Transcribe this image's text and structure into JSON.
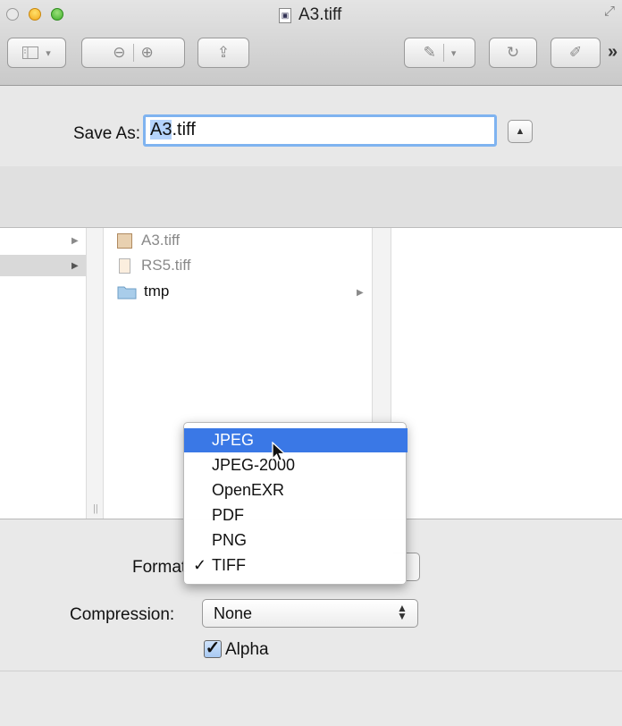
{
  "window": {
    "title": "A3.tiff",
    "title_icon_glyph": "▣",
    "fullscreen_glyph": "⤢"
  },
  "toolbar": {
    "sidebar_icon": "sidebar-icon",
    "zoom_out_glyph": "⊖",
    "zoom_in_glyph": "⊕",
    "share_glyph": "⇪",
    "annotate_glyph": "✎",
    "rotate_glyph": "↻",
    "edit_glyph": "✐",
    "dropdown_glyph": "▾",
    "overflow_glyph": "»"
  },
  "save": {
    "label": "Save As:",
    "filename_selected": "A3",
    "filename_rest": ".tiff",
    "collapse_glyph": "▲"
  },
  "browser": {
    "col1": {
      "disclosure_glyph": "▶"
    },
    "files": [
      {
        "name": "A3.tiff",
        "icon": "tiff-file-icon",
        "dimmed": true
      },
      {
        "name": "RS5.tiff",
        "icon": "tiff-file-icon",
        "dimmed": true
      },
      {
        "name": "tmp",
        "icon": "folder-icon",
        "dimmed": false
      }
    ],
    "grip_glyph": "||"
  },
  "format": {
    "label": "Format",
    "options": [
      "JPEG",
      "JPEG-2000",
      "OpenEXR",
      "PDF",
      "PNG",
      "TIFF"
    ],
    "highlighted": "JPEG",
    "selected": "TIFF",
    "check_glyph": "✓"
  },
  "compression": {
    "label": "Compression:",
    "value": "None",
    "arrows_glyph": "▲\n▼"
  },
  "alpha": {
    "label": "Alpha",
    "checked": true,
    "check_glyph": "✓"
  },
  "colors": {
    "accent": "#3a78e6",
    "focus_ring": "#7fb3f0"
  }
}
